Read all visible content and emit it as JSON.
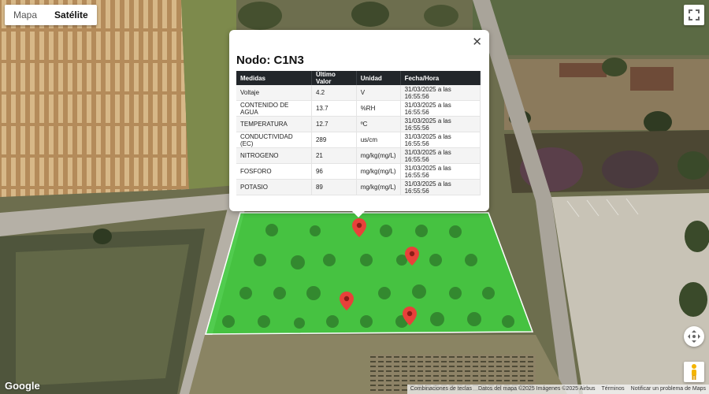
{
  "map_type": {
    "map_label": "Mapa",
    "satellite_label": "Satélite",
    "selected": "Satélite"
  },
  "popup": {
    "title": "Nodo: C1N3",
    "close_symbol": "✕",
    "table": {
      "headers": [
        "Medidas",
        "Último Valor",
        "Unidad",
        "Fecha/Hora"
      ],
      "rows": [
        [
          "Voltaje",
          "4.2",
          "V",
          "31/03/2025 a las 16:55:56"
        ],
        [
          "CONTENIDO DE AGUA",
          "13.7",
          "%RH",
          "31/03/2025 a las 16:55:56"
        ],
        [
          "TEMPERATURA",
          "12.7",
          "ºC",
          "31/03/2025 a las 16:55:56"
        ],
        [
          "CONDUCTIVIDAD (EC)",
          "289",
          "us/cm",
          "31/03/2025 a las 16:55:56"
        ],
        [
          "NITROGENO",
          "21",
          "mg/kg(mg/L)",
          "31/03/2025 a las 16:55:56"
        ],
        [
          "FOSFORO",
          "96",
          "mg/kg(mg/L)",
          "31/03/2025 a las 16:55:56"
        ],
        [
          "POTASIO",
          "89",
          "mg/kg(mg/L)",
          "31/03/2025 a las 16:55:56"
        ]
      ]
    }
  },
  "field": {
    "fill_color": "#3fd13f",
    "stroke_color": "#ffffff"
  },
  "markers": {
    "count": 4,
    "color": "#e8413a"
  },
  "google_logo": "Google",
  "footer": {
    "items": [
      "Combinaciones de teclas",
      "Datos del mapa ©2025 Imágenes ©2025 Airbus",
      "Términos",
      "Notificar un problema de Maps"
    ]
  },
  "icons": {
    "fullscreen": "fullscreen-icon",
    "camera": "camera-control-icon",
    "pegman": "pegman-icon"
  }
}
